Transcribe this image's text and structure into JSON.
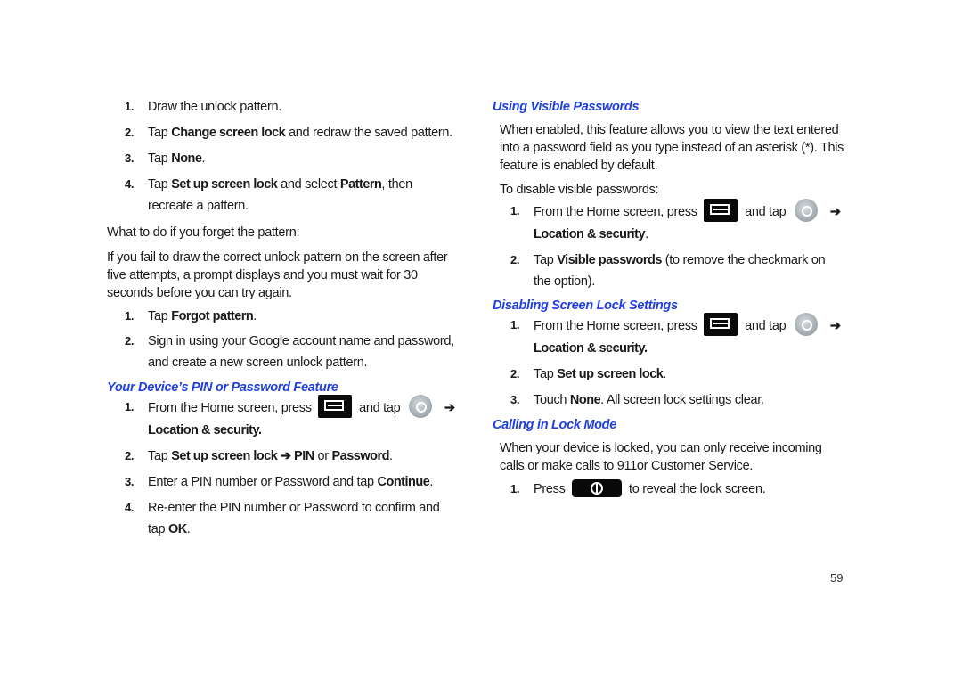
{
  "left": {
    "pattern_steps": [
      {
        "num": "1.",
        "parts": [
          "Draw the unlock pattern."
        ]
      },
      {
        "num": "2.",
        "pre": "Tap ",
        "bold": "Change screen lock",
        "post": " and redraw the saved pattern."
      },
      {
        "num": "3.",
        "pre": "Tap ",
        "bold": "None",
        "post": "."
      },
      {
        "num": "4.",
        "pre": "Tap ",
        "bold": "Set up screen lock",
        "mid": " and select ",
        "bold2": "Pattern",
        "post": ", then recreate a pattern."
      }
    ],
    "forgot_intro": "What to do if you forget the pattern:",
    "forgot_text": "If you fail to draw the correct unlock pattern on the screen after five attempts, a prompt displays and you must wait for 30 seconds before you can try again.",
    "forgot_steps": [
      {
        "num": "1.",
        "pre": "Tap ",
        "bold": "Forgot pattern",
        "post": "."
      },
      {
        "num": "2.",
        "text": "Sign in using your Google account name and password, and create a new screen unlock pattern."
      }
    ],
    "pin_heading": "Your Device’s PIN or Password Feature",
    "pin_steps": [
      {
        "num": "1.",
        "pre": "From the Home screen, press",
        "mid": "and tap",
        "bold": "Location & security."
      },
      {
        "num": "2.",
        "pre": "Tap ",
        "bold": "Set up screen lock ➔ PIN",
        "mid": " or ",
        "bold2": "Password",
        "post": "."
      },
      {
        "num": "3.",
        "pre": "Enter a PIN number or Password and tap ",
        "bold": "Continue",
        "post": "."
      },
      {
        "num": "4.",
        "pre": "Re-enter the PIN number or Password to confirm and tap ",
        "bold": "OK",
        "post": "."
      }
    ]
  },
  "right": {
    "visible_heading": "Using Visible Passwords",
    "visible_text": "When enabled, this feature allows you to view the text entered into a password field as you type instead of an asterisk (*). This feature is enabled by default.",
    "visible_intro": "To disable visible passwords:",
    "visible_steps": [
      {
        "num": "1.",
        "pre": "From the Home screen, press",
        "mid": "and tap",
        "bold": "Location & security",
        "post": "."
      },
      {
        "num": "2.",
        "pre": "Tap ",
        "bold": "Visible passwords",
        "post": " (to remove the checkmark on the option)."
      }
    ],
    "disable_heading": "Disabling Screen Lock Settings",
    "disable_steps": [
      {
        "num": "1.",
        "pre": "From the Home screen, press",
        "mid": "and tap",
        "bold": "Location & security."
      },
      {
        "num": "2.",
        "pre": "Tap ",
        "bold": "Set up screen lock",
        "post": "."
      },
      {
        "num": "3.",
        "pre": "Touch ",
        "bold": "None",
        "post": ". All screen lock settings clear."
      }
    ],
    "calling_heading": "Calling in Lock Mode",
    "calling_text": "When your device is locked, you can only receive incoming calls or make calls to 911or Customer Service.",
    "calling_steps": [
      {
        "num": "1.",
        "pre": "Press",
        "post": "to reveal the lock screen."
      }
    ]
  },
  "icons": {
    "menu": "menu-key-icon",
    "settings": "settings-icon",
    "power": "power-key-icon",
    "arrow": "➔"
  },
  "page_number": "59"
}
